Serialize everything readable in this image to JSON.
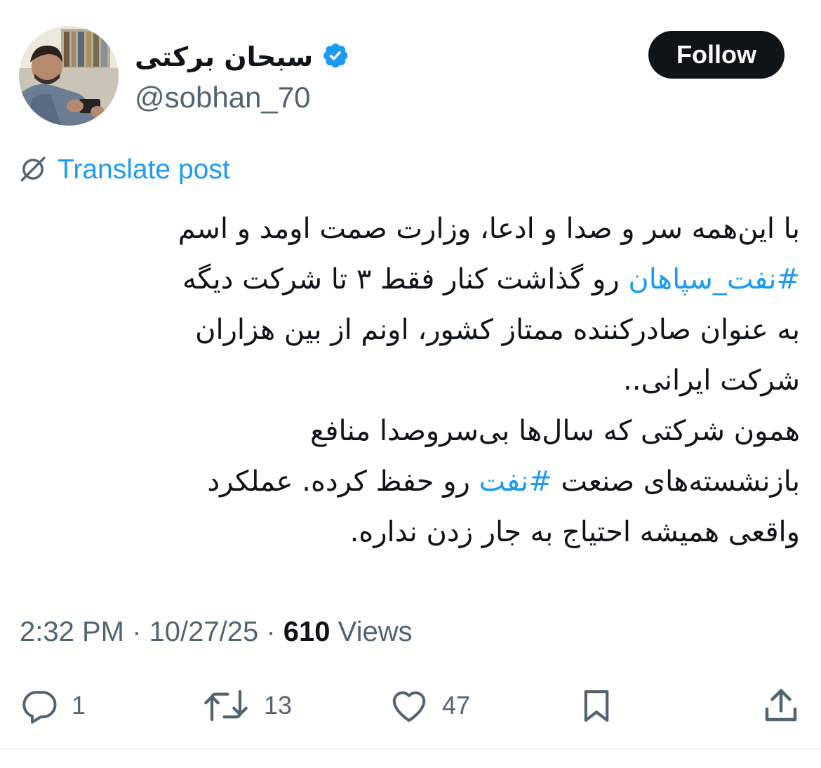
{
  "author": {
    "display_name": "سبحان برکتی",
    "handle": "@sobhan_70",
    "verified": true,
    "avatar_icon": "avatar-photo"
  },
  "follow_label": "Follow",
  "translate_label": "Translate post",
  "tweet_lines": [
    [
      {
        "t": "با این‌همه سر و صدا و ادعا، وزارت صمت اومد و اسم",
        "h": false
      }
    ],
    [
      {
        "t": "#نفت_سپاهان",
        "h": true
      },
      {
        "t": " رو گذاشت کنار فقط ۳ تا شرکت دیگه",
        "h": false
      }
    ],
    [
      {
        "t": "به عنوان صادرکننده ممتاز کشور، اونم از بین هزاران",
        "h": false
      }
    ],
    [
      {
        "t": "شرکت ایرانی..",
        "h": false
      }
    ],
    [
      {
        "t": "همون شرکتی که سال‌ها بی‌سروصدا منافع",
        "h": false
      }
    ],
    [
      {
        "t": "بازنشسته‌های صنعت ",
        "h": false
      },
      {
        "t": "#نفت",
        "h": true
      },
      {
        "t": " رو حفظ کرده. عملکرد",
        "h": false
      }
    ],
    [
      {
        "t": "واقعی همیشه احتیاج به جار زدن نداره.",
        "h": false
      }
    ]
  ],
  "meta": {
    "time": "2:32 PM",
    "date": "10/27/25",
    "separator": " · ",
    "views_count": "610",
    "views_label": "Views"
  },
  "actions": {
    "replies": "1",
    "reposts": "13",
    "likes": "47"
  },
  "colors": {
    "link_blue": "#1d9bf0",
    "text_primary": "#0f1419",
    "text_secondary": "#536471",
    "verified_badge": "#1d9bf0"
  }
}
